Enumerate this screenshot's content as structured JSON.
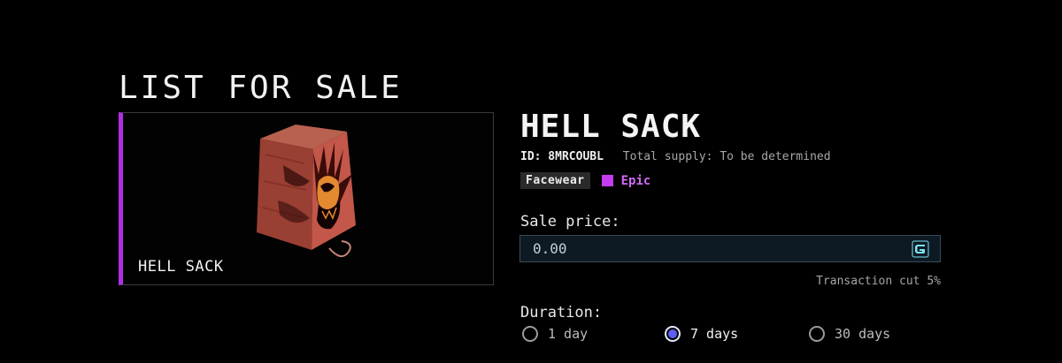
{
  "page": {
    "title": "LIST FOR SALE"
  },
  "item": {
    "card_name": "HELL SACK",
    "name": "HELL SACK",
    "id": "ID: 8MRCOUBL",
    "supply": "Total supply: To be determined",
    "type": "Facewear",
    "rarity": "Epic",
    "rarity_color": "#c53cf0",
    "image_icon": "hell-sack-mask-image"
  },
  "sale": {
    "price_label": "Sale price:",
    "price_value": "0.00",
    "currency_icon": "currency-g-icon",
    "transaction_cut": "Transaction cut 5%"
  },
  "duration": {
    "label": "Duration:",
    "options": [
      {
        "label": "1 day",
        "selected": false
      },
      {
        "label": "7 days",
        "selected": true
      },
      {
        "label": "30 days",
        "selected": false
      }
    ]
  },
  "colors": {
    "background": "#000000",
    "accent_purple": "#b02ee6",
    "radio_selected": "#5b5ff6",
    "input_bg": "#0d1a24"
  }
}
